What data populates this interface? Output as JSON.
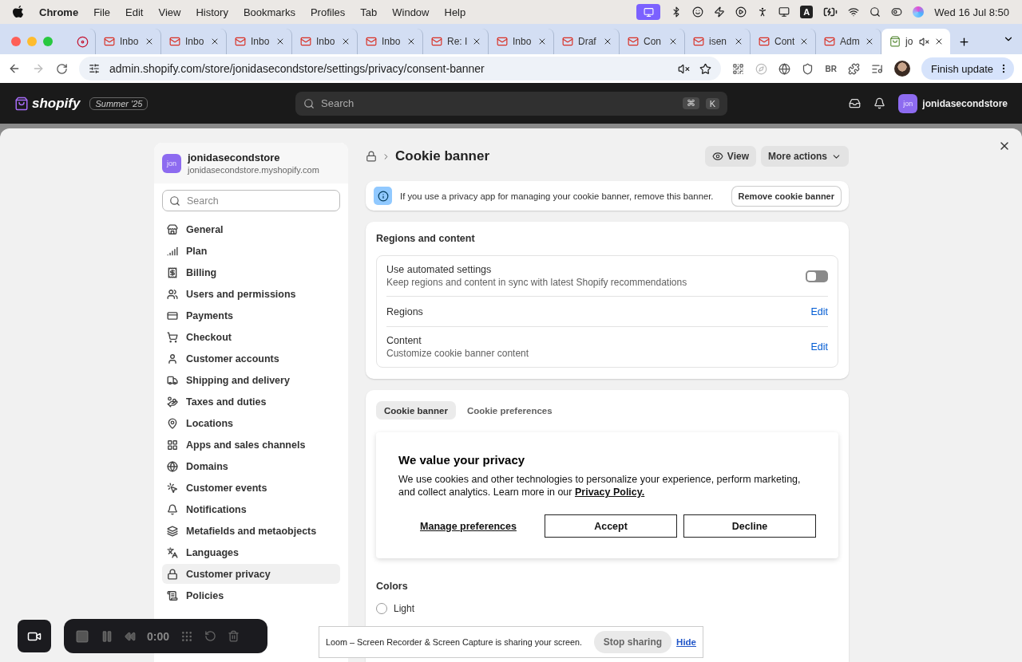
{
  "menu_bar": {
    "app": "Chrome",
    "items": [
      "File",
      "Edit",
      "View",
      "History",
      "Bookmarks",
      "Profiles",
      "Tab",
      "Window",
      "Help"
    ],
    "input_source": "A",
    "date_time": "Wed 16 Jul  8:50"
  },
  "browser": {
    "tabs": [
      {
        "selected": false
      },
      {
        "label": "Inbo",
        "selected": false
      },
      {
        "label": "Inbo",
        "selected": false
      },
      {
        "label": "Inbo",
        "selected": false
      },
      {
        "label": "Inbo",
        "selected": false
      },
      {
        "label": "Inbo",
        "selected": false
      },
      {
        "label": "Re: I",
        "selected": false
      },
      {
        "label": "Inbo",
        "selected": false
      },
      {
        "label": "Draf",
        "selected": false
      },
      {
        "label": "Con",
        "selected": false
      },
      {
        "label": "isen",
        "selected": false
      },
      {
        "label": "Cont",
        "selected": false
      },
      {
        "label": "Adm",
        "selected": false
      },
      {
        "label": "jo",
        "selected": true
      }
    ],
    "url": "admin.shopify.com/store/jonidasecondstore/settings/privacy/consent-banner",
    "extension_label": "BR",
    "update_button": "Finish update"
  },
  "shopify_bar": {
    "logo": "shopify",
    "edition": "Summer '25",
    "search_placeholder": "Search",
    "shortcut": [
      "⌘",
      "K"
    ],
    "store_avatar": "jon",
    "store": "jonidasecondstore"
  },
  "sidebar": {
    "avatar": "jon",
    "store_name": "jonidasecondstore",
    "store_domain": "jonidasecondstore.myshopify.com",
    "search_placeholder": "Search",
    "items": [
      {
        "label": "General",
        "selected": false
      },
      {
        "label": "Plan",
        "selected": false
      },
      {
        "label": "Billing",
        "selected": false
      },
      {
        "label": "Users and permissions",
        "selected": false
      },
      {
        "label": "Payments",
        "selected": false
      },
      {
        "label": "Checkout",
        "selected": false
      },
      {
        "label": "Customer accounts",
        "selected": false
      },
      {
        "label": "Shipping and delivery",
        "selected": false
      },
      {
        "label": "Taxes and duties",
        "selected": false
      },
      {
        "label": "Locations",
        "selected": false
      },
      {
        "label": "Apps and sales channels",
        "selected": false
      },
      {
        "label": "Domains",
        "selected": false
      },
      {
        "label": "Customer events",
        "selected": false
      },
      {
        "label": "Notifications",
        "selected": false
      },
      {
        "label": "Metafields and metaobjects",
        "selected": false
      },
      {
        "label": "Languages",
        "selected": false
      },
      {
        "label": "Customer privacy",
        "selected": true
      },
      {
        "label": "Policies",
        "selected": false
      }
    ]
  },
  "page": {
    "title": "Cookie banner",
    "view_button": "View",
    "more_actions": "More actions"
  },
  "notice": {
    "text": "If you use a privacy app for managing your cookie banner, remove this banner.",
    "button": "Remove cookie banner"
  },
  "regions_card": {
    "title": "Regions and content",
    "rows": [
      {
        "kind": "toggle",
        "title": "Use automated settings",
        "subtitle": "Keep regions and content in sync with latest Shopify recommendations",
        "on": false
      },
      {
        "kind": "link",
        "title": "Regions",
        "action": "Edit"
      },
      {
        "kind": "link",
        "title": "Content",
        "subtitle": "Customize cookie banner content",
        "action": "Edit"
      }
    ]
  },
  "preview": {
    "tabs": [
      {
        "label": "Cookie banner",
        "selected": true
      },
      {
        "label": "Cookie preferences",
        "selected": false
      }
    ],
    "title": "We value your privacy",
    "text": "We use cookies and other technologies to personalize your experience, perform marketing, and collect analytics. Learn more in our",
    "link": "Privacy Policy.",
    "manage": "Manage preferences",
    "buttons": [
      "Accept",
      "Decline"
    ]
  },
  "colors": {
    "title": "Colors",
    "options": [
      {
        "label": "Light",
        "selected": false
      }
    ]
  },
  "recorder": {
    "time": "0:00"
  },
  "loom_banner": {
    "text": "Loom – Screen Recorder & Screen Capture is sharing your screen.",
    "stop": "Stop sharing",
    "hide": "Hide"
  }
}
